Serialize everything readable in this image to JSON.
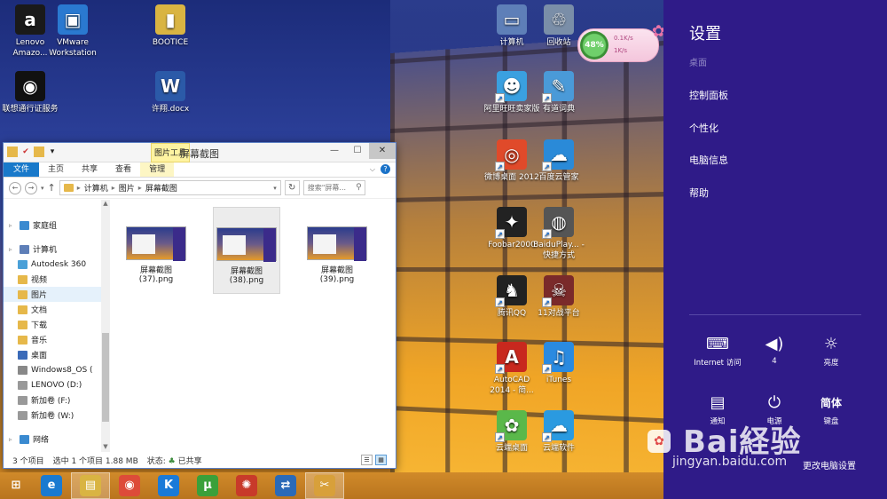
{
  "desktop": {
    "icons": [
      {
        "label": "Lenovo Amazo...",
        "icon": "amazon-icon",
        "glyph": "a",
        "color": "#1a1a1a"
      },
      {
        "label": "VMware Workstation",
        "icon": "vmware-icon",
        "glyph": "▣",
        "color": "#2a79d0"
      },
      {
        "label": "BOOTICE",
        "icon": "folder-icon",
        "glyph": "▮",
        "color": "#d9b442"
      },
      {
        "label": "联想通行证服务",
        "icon": "lenovo-id-icon",
        "glyph": "◉",
        "color": "#111"
      },
      {
        "label": "许翔.docx",
        "icon": "word-doc-icon",
        "glyph": "W",
        "color": "#2b5aa8"
      },
      {
        "label": "计算机",
        "icon": "computer-icon",
        "glyph": "▭",
        "color": "#5e7fb8"
      },
      {
        "label": "回收站",
        "icon": "recycle-bin-icon",
        "glyph": "♲",
        "color": "#7a8ea8"
      },
      {
        "label": "阿里旺旺卖家版",
        "icon": "aliwangwang-icon",
        "glyph": "☻",
        "color": "#3aa0e0"
      },
      {
        "label": "有道词典",
        "icon": "youdao-icon",
        "glyph": "✎",
        "color": "#4a9ad8"
      },
      {
        "label": "微博桌面 2012",
        "icon": "weibo-icon",
        "glyph": "◎",
        "color": "#e04a2a"
      },
      {
        "label": "百度云管家",
        "icon": "baidu-cloud-icon",
        "glyph": "☁",
        "color": "#2a8ad8"
      },
      {
        "label": "Foobar2000",
        "icon": "foobar-icon",
        "glyph": "✦",
        "color": "#222"
      },
      {
        "label": "BaiduPlay... - 快捷方式",
        "icon": "baiduplayer-icon",
        "glyph": "◍",
        "color": "#555"
      },
      {
        "label": "腾讯QQ",
        "icon": "qq-icon",
        "glyph": "♞",
        "color": "#222"
      },
      {
        "label": "11对战平台",
        "icon": "11-platform-icon",
        "glyph": "☠",
        "color": "#7a2a2a"
      },
      {
        "label": "AutoCAD 2014 - 简...",
        "icon": "autocad-icon",
        "glyph": "A",
        "color": "#c8281e"
      },
      {
        "label": "iTunes",
        "icon": "itunes-icon",
        "glyph": "♫",
        "color": "#2a8ae0"
      },
      {
        "label": "云端桌面",
        "icon": "cloud-desktop-icon",
        "glyph": "✿",
        "color": "#5ab84a"
      },
      {
        "label": "云端软件",
        "icon": "cloud-software-icon",
        "glyph": "☁",
        "color": "#2a9ae0"
      }
    ]
  },
  "explorer": {
    "title": "屏幕截图",
    "context_tab": "图片工具",
    "ribbon_tabs": [
      "文件",
      "主页",
      "共享",
      "查看",
      "管理"
    ],
    "breadcrumb": [
      "计算机",
      "图片",
      "屏幕截图"
    ],
    "search_placeholder": "搜索\"屏幕...",
    "nav_items": [
      {
        "label": "家庭组",
        "icon": "homegroup-icon",
        "color": "#3a8ad0"
      },
      {
        "label": "计算机",
        "icon": "computer-icon",
        "color": "#5e7fb8"
      },
      {
        "label": "Autodesk 360",
        "icon": "autodesk-icon",
        "color": "#4aa0d8"
      },
      {
        "label": "视频",
        "icon": "video-folder-icon",
        "color": "#e6b84a"
      },
      {
        "label": "图片",
        "icon": "pictures-folder-icon",
        "color": "#e6b84a"
      },
      {
        "label": "文档",
        "icon": "documents-folder-icon",
        "color": "#e6b84a"
      },
      {
        "label": "下载",
        "icon": "downloads-folder-icon",
        "color": "#e6b84a"
      },
      {
        "label": "音乐",
        "icon": "music-folder-icon",
        "color": "#e6b84a"
      },
      {
        "label": "桌面",
        "icon": "desktop-folder-icon",
        "color": "#3a6ab8"
      },
      {
        "label": "Windows8_OS (",
        "icon": "drive-icon",
        "color": "#888"
      },
      {
        "label": "LENOVO (D:)",
        "icon": "drive-icon",
        "color": "#999"
      },
      {
        "label": "新加卷 (F:)",
        "icon": "drive-icon",
        "color": "#999"
      },
      {
        "label": "新加卷 (W:)",
        "icon": "drive-icon",
        "color": "#999"
      },
      {
        "label": "网络",
        "icon": "network-icon",
        "color": "#3a8ad0"
      }
    ],
    "files": [
      {
        "name": "屏幕截图 (37).png"
      },
      {
        "name": "屏幕截图 (38).png"
      },
      {
        "name": "屏幕截图 (39).png"
      }
    ],
    "status": {
      "count": "3 个项目",
      "selection": "选中 1 个项目  1.88 MB",
      "state": "状态: ",
      "shared": "已共享"
    }
  },
  "gadget": {
    "percent": "48%",
    "up": "0.1K/s",
    "down": "1K/s"
  },
  "charm": {
    "title": "设置",
    "subtitle": "桌面",
    "links": [
      "控制面板",
      "个性化",
      "电脑信息",
      "帮助"
    ],
    "tiles": [
      {
        "label": "Internet 访问",
        "icon": "network-access-icon",
        "glyph": "⌨"
      },
      {
        "label": "4",
        "icon": "volume-icon",
        "glyph": "🔈"
      },
      {
        "label": "亮度",
        "icon": "brightness-icon",
        "glyph": "☼"
      },
      {
        "label": "通知",
        "icon": "notifications-icon",
        "glyph": "▤"
      },
      {
        "label": "电源",
        "icon": "power-icon",
        "glyph": "⏻"
      },
      {
        "label": "键盘",
        "icon": "keyboard-icon",
        "glyph": "简体"
      }
    ],
    "change_settings": "更改电脑设置"
  },
  "watermark": {
    "brand": "Bai経验",
    "url": "jingyan.baidu.com"
  },
  "taskbar": {
    "items": [
      {
        "icon": "windows-start-icon",
        "glyph": "⊞",
        "color": "transparent"
      },
      {
        "icon": "internet-explorer-icon",
        "glyph": "e",
        "color": "#1a7ad0"
      },
      {
        "icon": "file-explorer-icon",
        "glyph": "▤",
        "color": "#d9b442"
      },
      {
        "icon": "chrome-icon",
        "glyph": "◉",
        "color": "#dd4b39"
      },
      {
        "icon": "kugou-icon",
        "glyph": "K",
        "color": "#1a7ad8"
      },
      {
        "icon": "utorrent-icon",
        "glyph": "µ",
        "color": "#3aa03a"
      },
      {
        "icon": "app-swirl-icon",
        "glyph": "✺",
        "color": "#c83a2a"
      },
      {
        "icon": "network-app-icon",
        "glyph": "⇄",
        "color": "#2a6ab8"
      },
      {
        "icon": "paint-icon",
        "glyph": "✂",
        "color": "#d8a03a"
      }
    ]
  }
}
